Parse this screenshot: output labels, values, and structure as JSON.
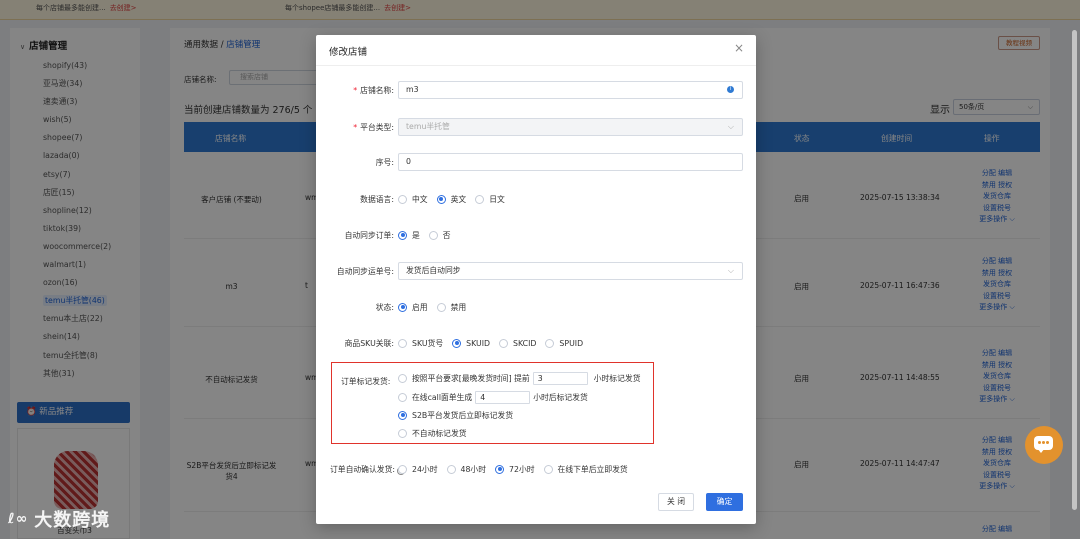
{
  "topbar": {
    "notice1": "每个店铺最多能创建...",
    "warn1": "去创建>",
    "notice2": "每个shopee店铺最多能创建...",
    "warn2": "去创建>"
  },
  "sidebar": {
    "title": "店铺管理",
    "items": [
      "shopify(43)",
      "亚马逊(34)",
      "速卖通(3)",
      "wish(5)",
      "shopee(7)",
      "lazada(0)",
      "etsy(7)",
      "店匠(15)",
      "shopline(12)",
      "tiktok(39)",
      "woocommerce(2)",
      "walmart(1)",
      "ozon(16)",
      "temu半托管(46)",
      "temu本土店(22)",
      "shein(14)",
      "temu全托管(8)",
      "其他(31)"
    ],
    "active_index": 13,
    "promo_button": "新品推荐",
    "promo_caption": "百变头巾3"
  },
  "content": {
    "breadcrumb_root": "通用数据 /",
    "breadcrumb_current": "店铺管理",
    "guide_button": "教程视频",
    "filter_label": "店铺名称:",
    "filter_placeholder": "搜索店铺",
    "count_text": "当前创建店铺数量为 276/5 个",
    "show_label": "显示",
    "page_size": "50条/页",
    "columns": {
      "name": "店铺名称",
      "state": "状态",
      "created": "创建时间",
      "ops": "操作"
    },
    "rows": [
      {
        "name": "客户店铺 (不要动)",
        "w": "wm",
        "state": "启用",
        "time": "2025-07-15 13:38:34"
      },
      {
        "name": "m3",
        "w": "t",
        "state": "启用",
        "time": "2025-07-11 16:47:36"
      },
      {
        "name": "不自动标记发货",
        "w": "wm",
        "state": "启用",
        "time": "2025-07-11 14:48:55"
      },
      {
        "name": "S2B平台发货后立即标记发货4",
        "w": "wm",
        "state": "启用",
        "time": "2025-07-11 14:47:47"
      }
    ],
    "op_links": {
      "assign": "分配",
      "edit": "编辑",
      "disable": "禁用",
      "authorize": "授权",
      "ship_warehouse": "发货仓库",
      "set_tax": "设置税号",
      "more": "更多操作"
    },
    "last_row_ops": "分配  编辑"
  },
  "modal": {
    "title": "修改店铺",
    "store_name_label": "店铺名称:",
    "store_name_value": "m3",
    "platform_label": "平台类型:",
    "platform_value": "temu半托管",
    "seq_label": "序号:",
    "seq_value": "0",
    "lang_label": "数据语言:",
    "lang_options": [
      "中文",
      "英文",
      "日文"
    ],
    "lang_selected": 1,
    "auto_sync_label": "自动同步订单:",
    "auto_sync_options": [
      "是",
      "否"
    ],
    "auto_sync_selected": 0,
    "track_sync_label": "自动同步运单号:",
    "track_sync_value": "发货后自动同步",
    "status_label": "状态:",
    "status_options": [
      "启用",
      "禁用"
    ],
    "status_selected": 0,
    "sku_label": "商品SKU关联:",
    "sku_options": [
      "SKU货号",
      "SKUID",
      "SKCID",
      "SPUID"
    ],
    "sku_selected": 1,
    "mark_label": "订单标记发货:",
    "mark_opt1_prefix": "按照平台要求[最晚发货时间] 提前",
    "mark_opt1_value": "3",
    "mark_opt1_suffix": "小时标记发货",
    "mark_opt2_prefix": "在线call面单生成",
    "mark_opt2_value": "4",
    "mark_opt2_suffix": "小时后标记发货",
    "mark_opt3": "S2B平台发货后立即标记发货",
    "mark_opt4": "不自动标记发货",
    "confirm_label": "订单自动确认发货:",
    "confirm_options": [
      "24小时",
      "48小时",
      "72小时",
      "在线下单后立即发货"
    ],
    "confirm_selected": 2,
    "cancel_button": "关 闭",
    "ok_button": "确定"
  },
  "watermark": {
    "logo": "ℓ∞",
    "text": "大数跨境"
  },
  "colors": {
    "primary": "#2f6fe0",
    "header": "#2f7ad3",
    "highlight": "#e0332b",
    "fab": "#e3922d"
  }
}
